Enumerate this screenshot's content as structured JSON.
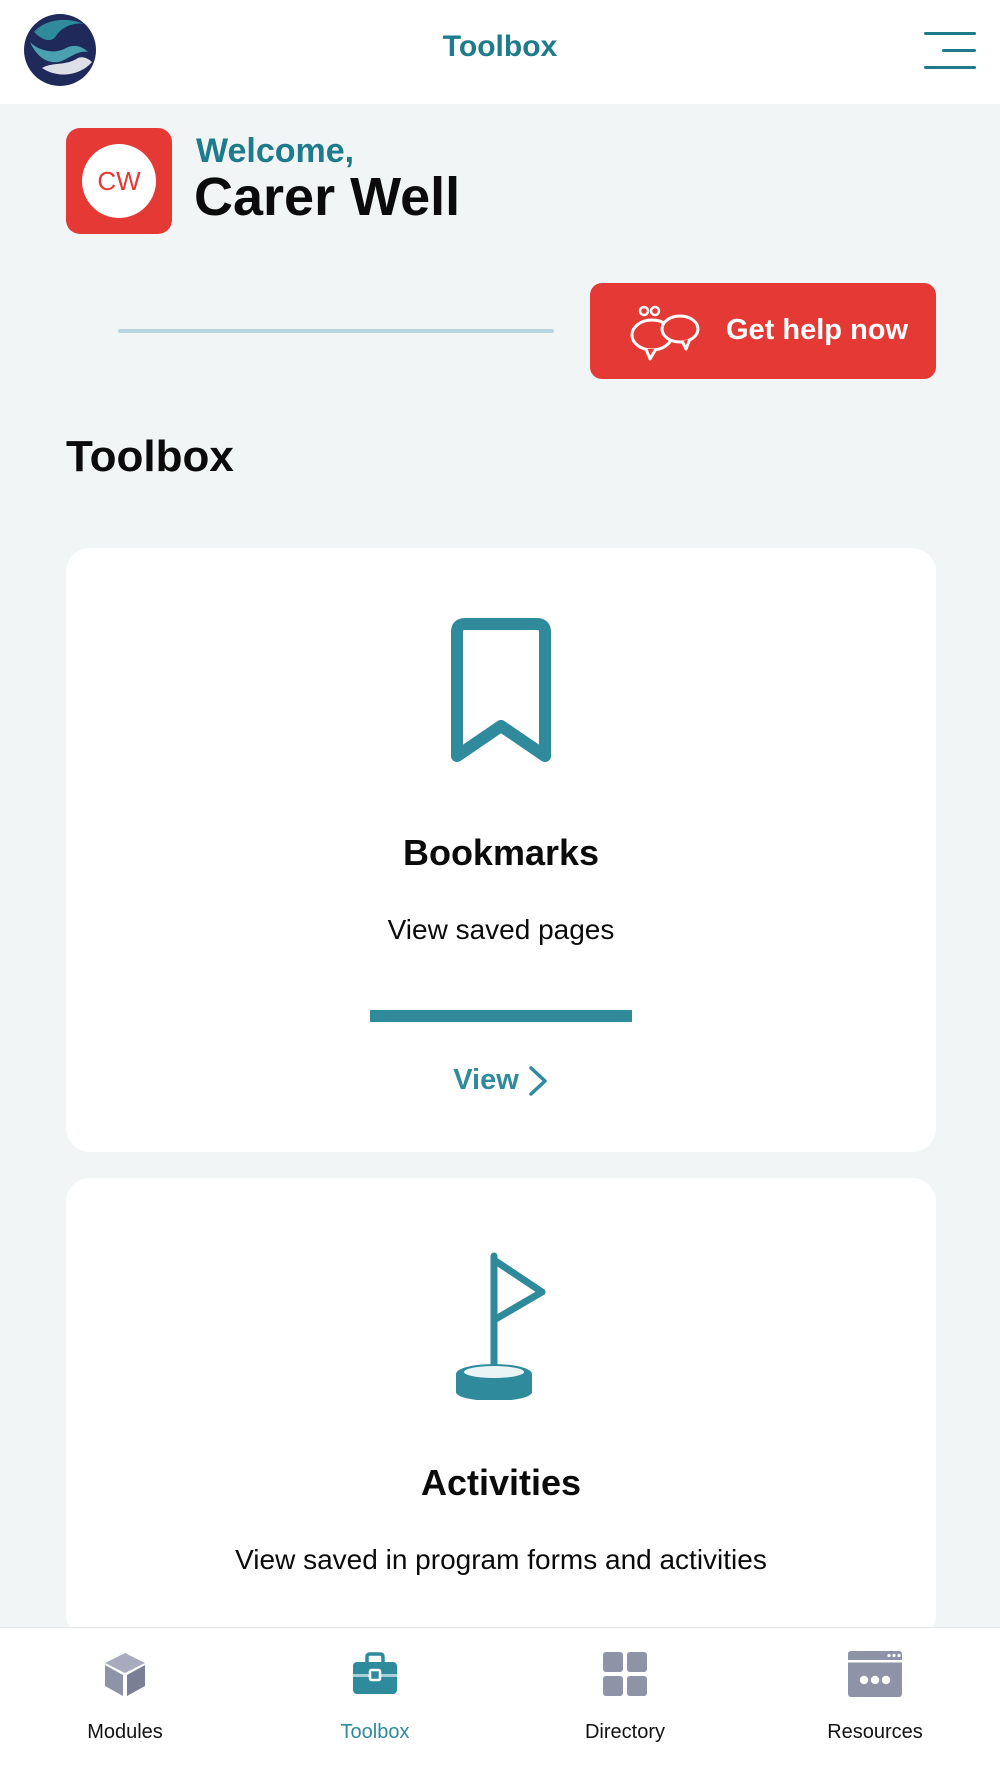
{
  "header": {
    "title": "Toolbox",
    "logo_icon": "hands-globe-logo-icon",
    "menu_icon": "hamburger-menu-icon"
  },
  "user": {
    "greeting": "Welcome,",
    "name": "Carer Well",
    "initials": "CW"
  },
  "help_button": {
    "label": "Get help now",
    "icon": "chat-bubbles-icon"
  },
  "section": {
    "title": "Toolbox"
  },
  "cards": [
    {
      "title": "Bookmarks",
      "description": "View saved pages",
      "link": "View",
      "icon": "bookmark-icon"
    },
    {
      "title": "Activities",
      "description": "View saved in program forms and activities",
      "icon": "flag-icon"
    }
  ],
  "bottom_nav": {
    "items": [
      {
        "label": "Modules",
        "icon": "cube-icon",
        "active": false
      },
      {
        "label": "Toolbox",
        "icon": "briefcase-icon",
        "active": true
      },
      {
        "label": "Directory",
        "icon": "grid-icon",
        "active": false
      },
      {
        "label": "Resources",
        "icon": "browser-window-icon",
        "active": false
      }
    ]
  },
  "colors": {
    "brand_teal": "#1e7b8c",
    "accent_red": "#e53935",
    "icon_teal": "#2f8a9c",
    "nav_inactive": "#8e93a8",
    "page_background": "#f2f5f6"
  }
}
